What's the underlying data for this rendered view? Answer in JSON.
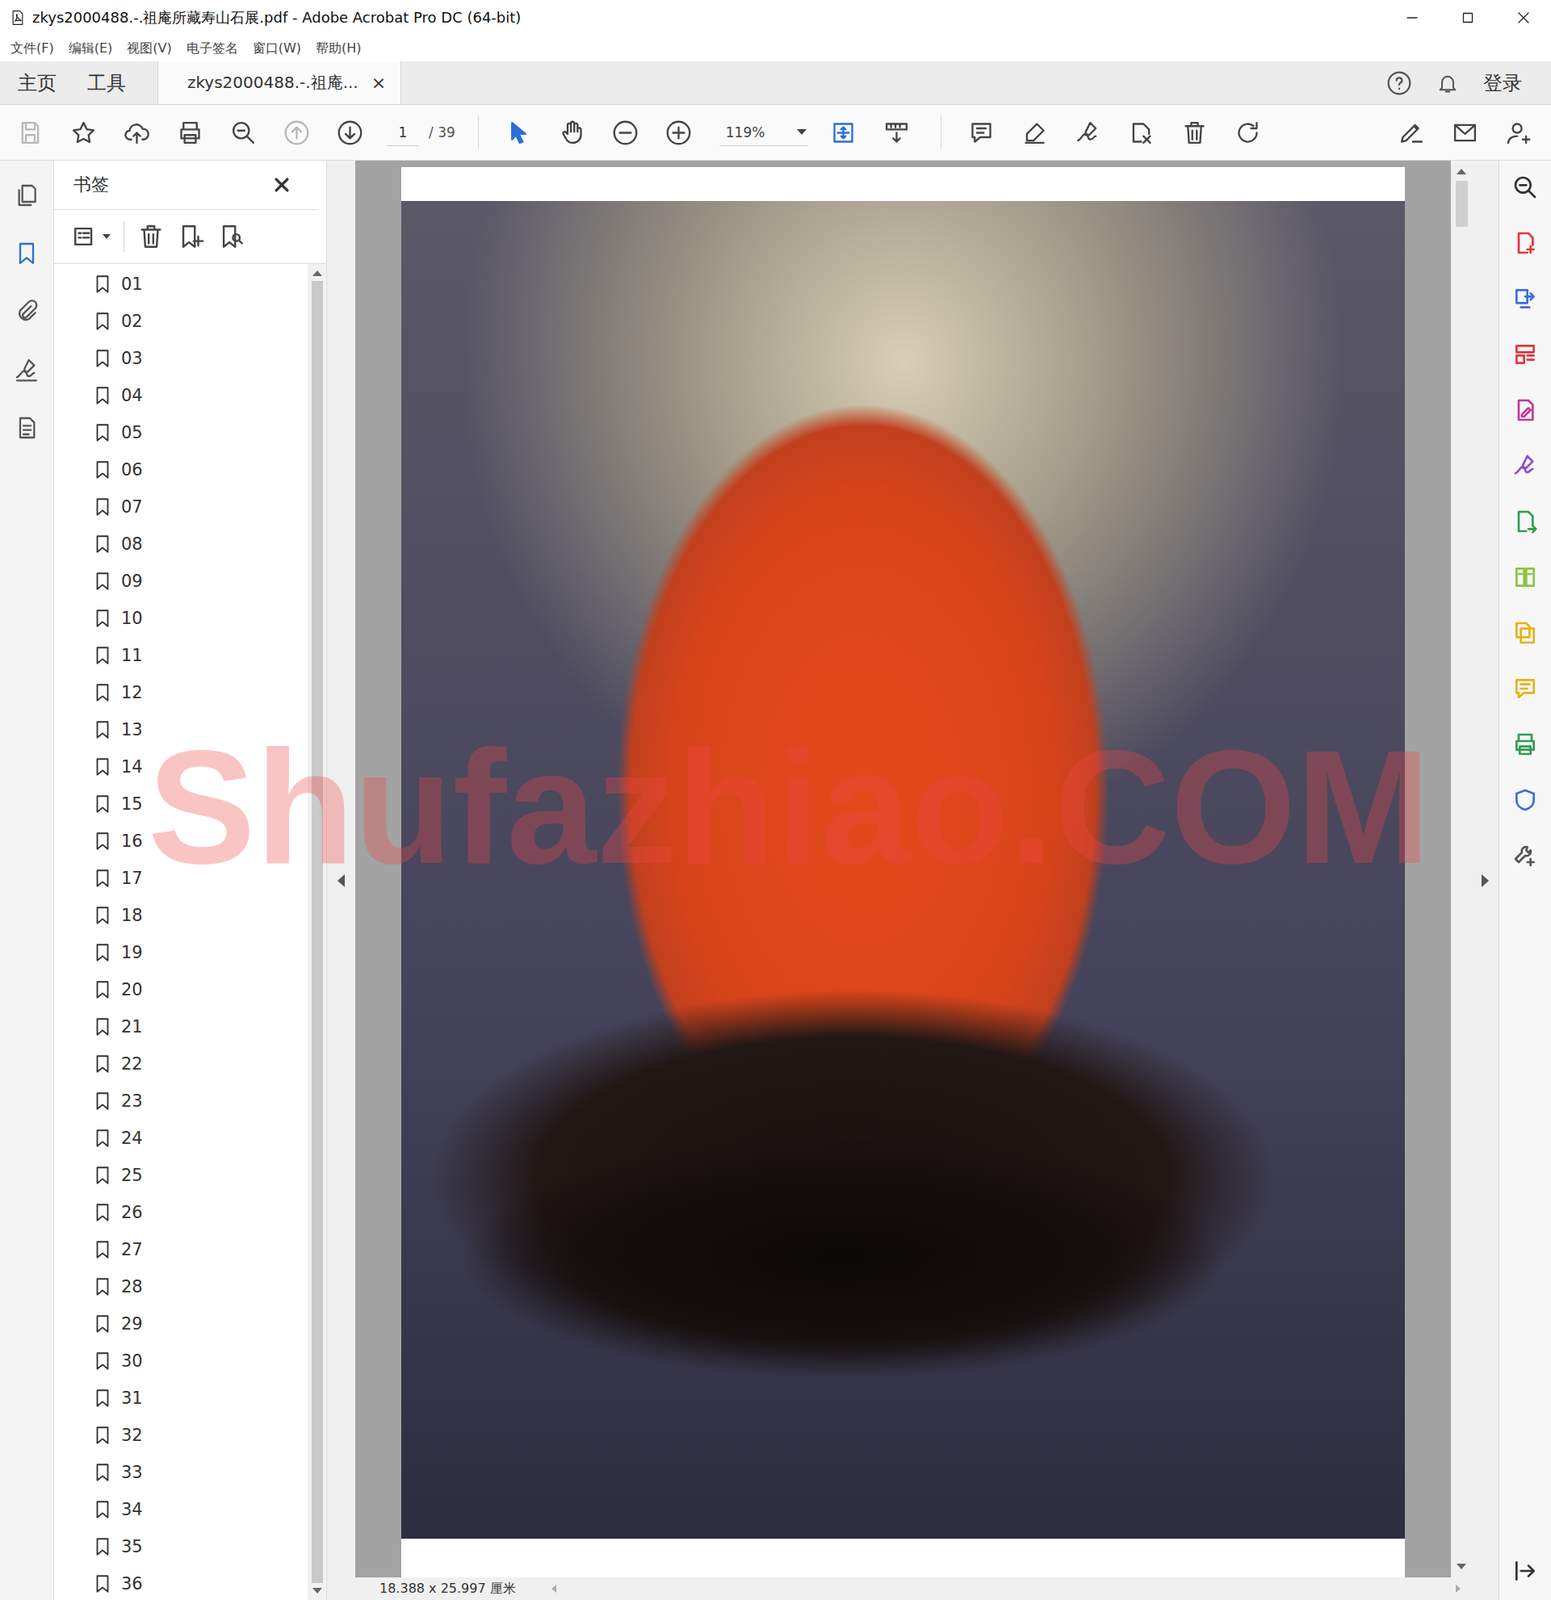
{
  "window": {
    "title": "zkys2000488.-.祖庵所藏寿山石展.pdf - Adobe Acrobat Pro DC (64-bit)"
  },
  "menu": [
    "文件(F)",
    "编辑(E)",
    "视图(V)",
    "电子签名",
    "窗口(W)",
    "帮助(H)"
  ],
  "tabs": [
    {
      "label": "主页",
      "selected": false
    },
    {
      "label": "工具",
      "selected": false
    },
    {
      "label": "zkys2000488.-.祖庵...",
      "selected": true,
      "close": "×"
    }
  ],
  "header_right": {
    "login": "登录"
  },
  "toolbar": {
    "left": [
      {
        "kind": "save",
        "disabled": true
      },
      {
        "kind": "star",
        "disabled": false
      },
      {
        "kind": "upload",
        "disabled": false
      },
      {
        "kind": "print",
        "disabled": false
      },
      {
        "kind": "find",
        "disabled": false
      },
      {
        "kind": "prev-page",
        "disabled": true
      },
      {
        "kind": "next-page",
        "disabled": false
      }
    ],
    "page": "1",
    "page_total": "/ 39",
    "view": [
      {
        "kind": "select",
        "selected": true
      },
      {
        "kind": "hand",
        "selected": false
      },
      {
        "kind": "zoom-out",
        "selected": false
      },
      {
        "kind": "zoom-in",
        "selected": false
      }
    ],
    "zoom": "119%",
    "fit": [
      {
        "kind": "fit-page",
        "selected": false
      },
      {
        "kind": "measure",
        "selected": false
      }
    ],
    "edit": [
      {
        "kind": "comment"
      },
      {
        "kind": "highlight"
      },
      {
        "kind": "draw"
      },
      {
        "kind": "stamp"
      },
      {
        "kind": "delete"
      },
      {
        "kind": "rotate"
      }
    ],
    "right": [
      {
        "kind": "sign"
      },
      {
        "kind": "mail"
      },
      {
        "kind": "share-user"
      }
    ]
  },
  "left_rail": [
    {
      "kind": "pages",
      "selected": false
    },
    {
      "kind": "bookmarks",
      "selected": true
    },
    {
      "kind": "attachments",
      "selected": false
    },
    {
      "kind": "signatures",
      "selected": false
    },
    {
      "kind": "content",
      "selected": false
    }
  ],
  "bookmarks": {
    "title": "书签",
    "items": [
      "01",
      "02",
      "03",
      "04",
      "05",
      "06",
      "07",
      "08",
      "09",
      "10",
      "11",
      "12",
      "13",
      "14",
      "15",
      "16",
      "17",
      "18",
      "19",
      "20",
      "21",
      "22",
      "23",
      "24",
      "25",
      "26",
      "27",
      "28",
      "29",
      "30",
      "31",
      "32",
      "33",
      "34",
      "35",
      "36"
    ]
  },
  "right_rail": [
    {
      "kind": "find",
      "color": "#333333"
    },
    {
      "kind": "create",
      "color": "#e4343f"
    },
    {
      "kind": "export",
      "color": "#3b6ee0"
    },
    {
      "kind": "organize",
      "color": "#e4343f"
    },
    {
      "kind": "edit-pdf",
      "color": "#c0399e"
    },
    {
      "kind": "fill-sign",
      "color": "#8a4fd0"
    },
    {
      "kind": "send",
      "color": "#2e9e4f"
    },
    {
      "kind": "compare",
      "color": "#8ac43f"
    },
    {
      "kind": "combine",
      "color": "#e9b10f"
    },
    {
      "kind": "comment",
      "color": "#e9b10f"
    },
    {
      "kind": "print-production",
      "color": "#2e9e4f"
    },
    {
      "kind": "protect",
      "color": "#3b6ee0"
    },
    {
      "kind": "more-tools",
      "color": "#555555"
    }
  ],
  "status": {
    "page_size": "18.388 x 25.997 厘米"
  },
  "watermark": "Shufazhiao.COM"
}
